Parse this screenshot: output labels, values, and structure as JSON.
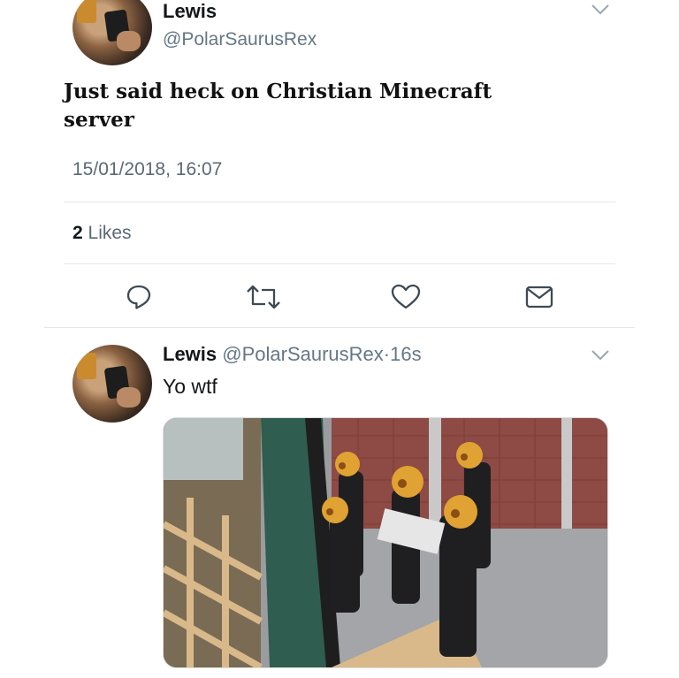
{
  "tweet": {
    "author_name": "Lewis",
    "author_handle": "@PolarSaurusRex",
    "text": "Just said heck on Christian Minecraft server",
    "timestamp": "15/01/2018, 16:07",
    "likes_count": "2",
    "likes_label": "Likes"
  },
  "actions": [
    "reply-icon",
    "retweet-icon",
    "like-icon",
    "share-icon"
  ],
  "reply": {
    "author_name": "Lewis",
    "author_handle": "@PolarSaurusRex",
    "separator": "·",
    "time": "16s",
    "text": "Yo wtf"
  },
  "colors": {
    "text": "#14171a",
    "secondary": "#657786",
    "divider": "#e1e8ed",
    "icon": "#3d4a55"
  }
}
